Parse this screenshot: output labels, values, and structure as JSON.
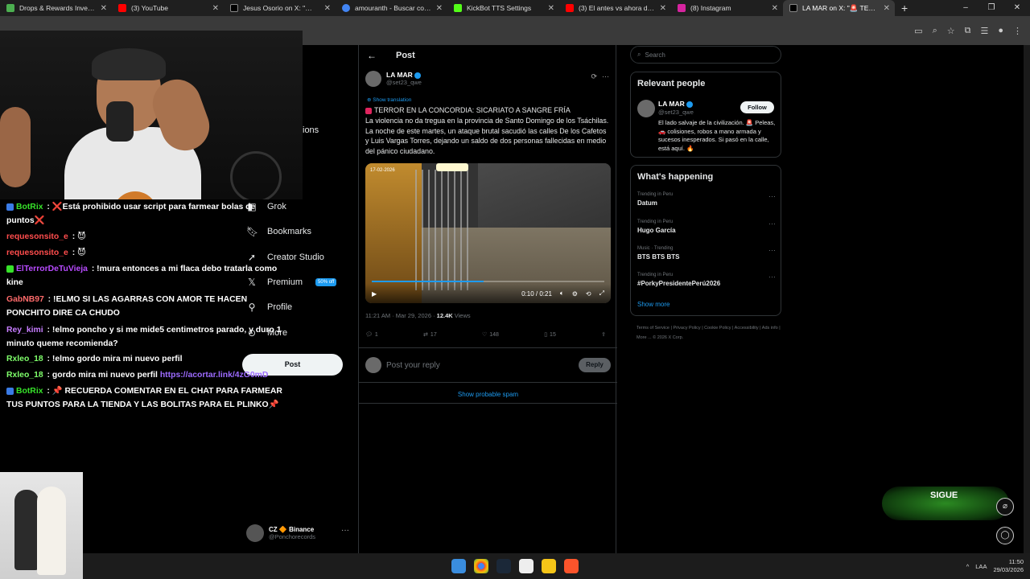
{
  "browser": {
    "tabs": [
      {
        "label": "Drops & Rewards Invento",
        "color": "#4caf50"
      },
      {
        "label": "(3) YouTube",
        "color": "#ff0000"
      },
      {
        "label": "Jesus Osorio on X: \"🚨 Ar",
        "color": "#000000"
      },
      {
        "label": "amouranth - Buscar con G",
        "color": "#4285f4"
      },
      {
        "label": "KickBot TTS Settings",
        "color": "#53fc18"
      },
      {
        "label": "(3) El antes vs ahora de p",
        "color": "#ff0000"
      },
      {
        "label": "(8) Instagram",
        "color": "#d6249f"
      },
      {
        "label": "LA MAR on X: \"🚨 TERRO",
        "color": "#000000"
      }
    ],
    "new_tab": "+",
    "window_controls": [
      "–",
      "❐",
      "✕"
    ]
  },
  "x_nav": {
    "items": [
      {
        "label": "Grok",
        "icon": "grok-icon"
      },
      {
        "label": "Bookmarks",
        "icon": "bookmark-icon"
      },
      {
        "label": "Creator Studio",
        "icon": "rocket-icon"
      },
      {
        "label": "Premium",
        "icon": "x-logo-icon"
      },
      {
        "label": "Profile",
        "icon": "person-icon"
      },
      {
        "label": "More",
        "icon": "more-circle-icon"
      }
    ],
    "partial_label": "ions",
    "premium_badge": "50% off",
    "post_button": "Post",
    "account": {
      "name": "CZ 🔶 Binance",
      "handle": "@Ponchorecords",
      "more": "···"
    }
  },
  "chat": {
    "messages": [
      {
        "user": "BotRix",
        "user_color": "#37e22a",
        "text": "❌Está prohibido usar script para farmear bolas de puntos❌",
        "bot": true
      },
      {
        "user": "requesonsito_e",
        "user_color": "#ff4d4d",
        "text": "😈",
        "bot": false
      },
      {
        "user": "requesonsito_e",
        "user_color": "#ff4d4d",
        "text": "😈",
        "bot": false
      },
      {
        "user": "ElTerrorDeTuVieja",
        "user_color": "#b84bff",
        "text": "!mura entonces a mi flaca debo tratarla como kine",
        "bot": false
      },
      {
        "user": "GabNB97",
        "user_color": "#ff6b6b",
        "text": "!ELMO SI LAS AGARRAS CON AMOR TE HACEN PONCHITO DIRE CA CHUDO",
        "bot": false
      },
      {
        "user": "Rey_kimi",
        "user_color": "#c77dff",
        "text": "!elmo poncho y si me mide5 centimetros parado, y duro 1 minuto queme recomienda?",
        "bot": false
      },
      {
        "user": "Rxleo_18",
        "user_color": "#7fff6b",
        "text": "!elmo gordo mira mi nuevo perfil",
        "bot": false
      },
      {
        "user": "Rxleo_18",
        "user_color": "#7fff6b",
        "text": "gordo mira mi nuevo perfil ",
        "link": "https://acortar.link/4zG0mD",
        "bot": false
      },
      {
        "user": "BotRix",
        "user_color": "#37e22a",
        "text": "📌 RECUERDA COMENTAR EN EL CHAT PARA FARMEAR TUS PUNTOS PARA LA TIENDA Y LAS BOLITAS PARA EL PLINKO📌",
        "bot": true
      }
    ]
  },
  "post": {
    "header_title": "Post",
    "author_name": "LA MAR",
    "author_handle": "@set23_qwe",
    "show_translation": "Show translation",
    "headline": "TERROR EN LA CONCORDIA: SICARIATO A SANGRE FRÍA",
    "body": "La violencia no da tregua en la provincia de Santo Domingo de los Tsáchilas. La noche de este martes, un ataque brutal sacudió las calles De los Cafetos y Luis Vargas Torres, dejando un saldo de dos personas fallecidas en medio del pánico ciudadano.",
    "video_stamp": "17-02-2026",
    "video_time": "0:10 / 0:21",
    "video_progress": 0.48,
    "time": "11:21 AM · Mar 29, 2026 · ",
    "views_count": "12.4K",
    "views_label": " Views",
    "replies": "1",
    "reposts": "17",
    "likes": "148",
    "bookmarks": "15",
    "reply_placeholder": "Post your reply",
    "reply_button": "Reply",
    "spam_link": "Show probable spam"
  },
  "sidebar": {
    "search_placeholder": "Search",
    "relevant_title": "Relevant people",
    "person_name": "LA MAR",
    "person_handle": "@set23_qwe",
    "follow_label": "Follow",
    "person_bio": "El lado salvaje de la civilización. 🚨 Peleas, 🚗 colisiones, robos a mano armada y sucesos inesperados. Si pasó en la calle, está aquí. 🔥",
    "happening_title": "What's happening",
    "trends": [
      {
        "context": "Trending in Peru",
        "name": "Datum"
      },
      {
        "context": "Trending in Peru",
        "name": "Hugo García"
      },
      {
        "context": "Music · Trending",
        "name": "BTS BTS BTS"
      },
      {
        "context": "Trending in Peru",
        "name": "#PorkyPresidentePerú2026"
      }
    ],
    "show_more": "Show more",
    "footer": "Terms of Service  |  Privacy Policy  |  Cookie Policy  |  Accessibility  |  Ads info  |  More ...  © 2026 X Corp."
  },
  "overlay": {
    "green_text": "SIGUE"
  },
  "taskbar": {
    "lang": "LAA",
    "time": "11:50",
    "date": "29/03/2026",
    "caret": "^"
  }
}
